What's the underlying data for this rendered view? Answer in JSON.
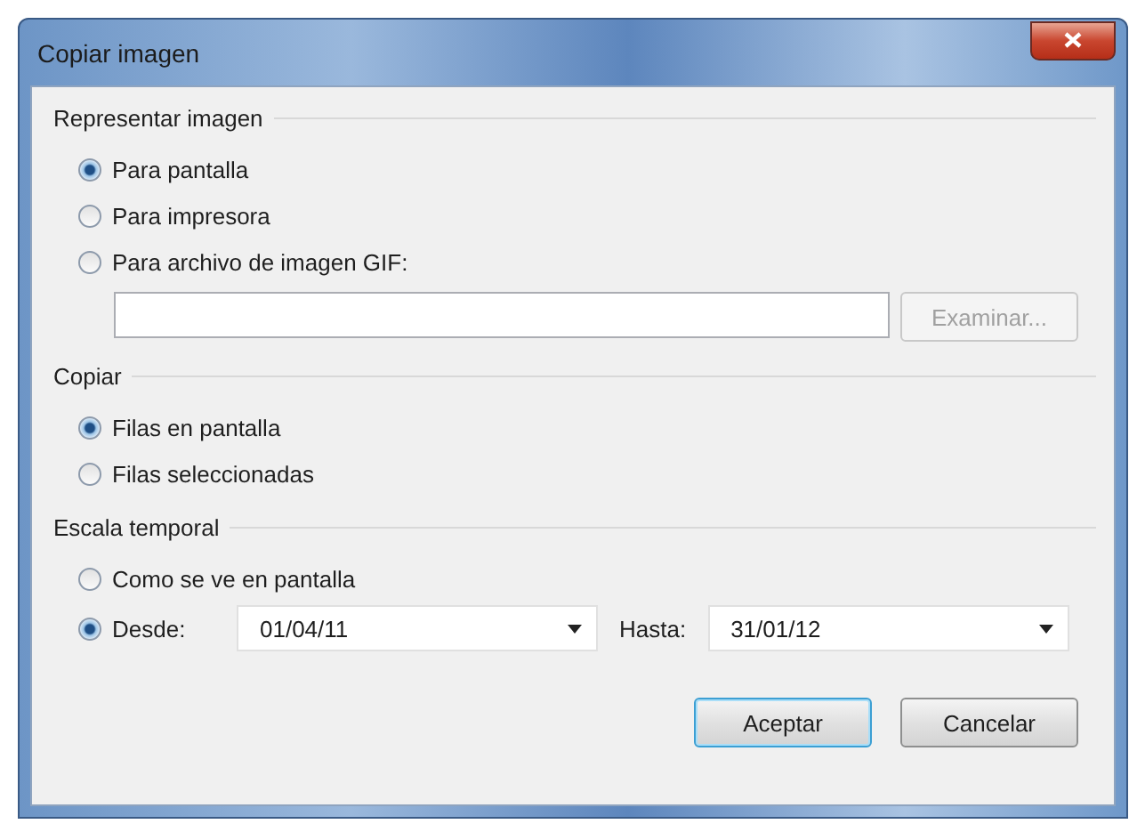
{
  "window": {
    "title": "Copiar imagen"
  },
  "groups": [
    {
      "title": "Representar imagen",
      "options": [
        {
          "kind": "plain",
          "label": "Para pantalla",
          "selected": true
        },
        {
          "kind": "plain",
          "label": "Para impresora",
          "selected": false
        },
        {
          "kind": "file",
          "label": "Para archivo de imagen GIF:",
          "selected": false,
          "browse_button": {
            "label": "Examinar...",
            "disabled": true
          }
        }
      ]
    },
    {
      "title": "Copiar",
      "options": [
        {
          "kind": "plain",
          "label": "Filas en pantalla",
          "selected": true
        },
        {
          "kind": "plain",
          "label": "Filas seleccionadas",
          "selected": false
        }
      ]
    },
    {
      "title": "Escala temporal",
      "options": [
        {
          "kind": "plain",
          "label": "Como se ve en pantalla",
          "selected": false
        },
        {
          "kind": "range",
          "label": "Desde:",
          "selected": true,
          "from": "01/04/11",
          "to_label": "Hasta:",
          "to": "31/01/12"
        }
      ]
    }
  ],
  "buttons": [
    {
      "label": "Aceptar",
      "default": true
    },
    {
      "label": "Cancelar",
      "default": false
    }
  ]
}
